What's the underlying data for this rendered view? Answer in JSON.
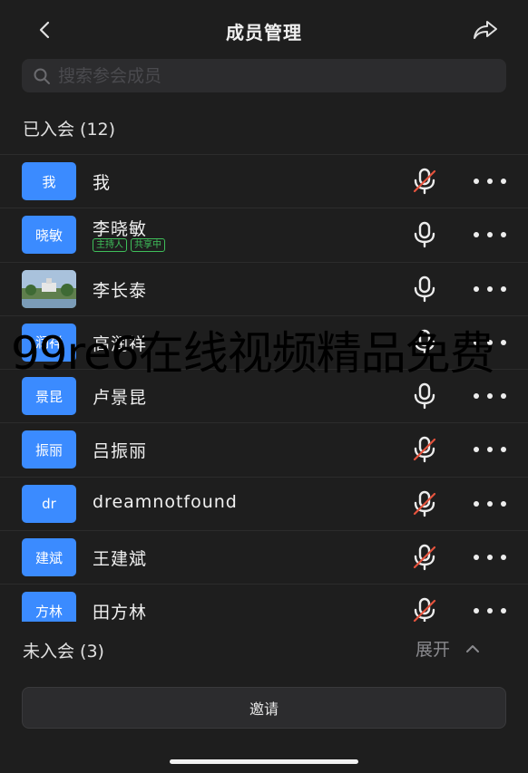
{
  "header": {
    "title": "成员管理"
  },
  "search": {
    "placeholder": "搜索参会成员"
  },
  "joined": {
    "label": "已入会 (12)"
  },
  "members": [
    {
      "avatar_text": "我",
      "name": "我",
      "tags": [],
      "mic": "muted"
    },
    {
      "avatar_text": "晓敏",
      "name": "李晓敏",
      "tags": [
        "主持人",
        "共享中"
      ],
      "mic": "on"
    },
    {
      "avatar_text": "",
      "name": "李长泰",
      "tags": [],
      "mic": "on",
      "avatar_photo": true
    },
    {
      "avatar_text": "润祥",
      "name": "高润祥",
      "tags": [],
      "mic": "on"
    },
    {
      "avatar_text": "景昆",
      "name": "卢景昆",
      "tags": [],
      "mic": "on"
    },
    {
      "avatar_text": "振丽",
      "name": "吕振丽",
      "tags": [],
      "mic": "muted"
    },
    {
      "avatar_text": "dr",
      "name": "dreamnotfound",
      "tags": [],
      "mic": "muted"
    },
    {
      "avatar_text": "建斌",
      "name": "王建斌",
      "tags": [],
      "mic": "muted"
    },
    {
      "avatar_text": "方林",
      "name": "田方林",
      "tags": [],
      "mic": "muted"
    }
  ],
  "not_joined": {
    "label": "未入会 (3)",
    "expand_label": "展开"
  },
  "invite": {
    "label": "邀请"
  },
  "watermark": "99re6在线视频精品免费",
  "colors": {
    "accent": "#3b8bff",
    "tag_green": "#3fbf5a",
    "mute_red": "#e5533d",
    "background": "#1e1e1e"
  }
}
